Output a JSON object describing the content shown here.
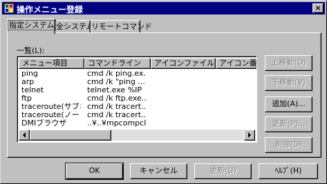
{
  "window": {
    "title": "操作メニュー登録",
    "close_glyph": "×"
  },
  "tabs": [
    {
      "label": "指定システム",
      "active": true
    },
    {
      "label": "全システム",
      "active": false
    },
    {
      "label": "リモートコマンド",
      "active": false
    }
  ],
  "list": {
    "label": "一覧(L):",
    "columns": [
      "メニュー項目",
      "コマンドライン",
      "アイコンファイル",
      "アイコン番号"
    ],
    "rows": [
      [
        "ping",
        "cmd /k ping.ex..."
      ],
      [
        "arp",
        "cmd /k \"ping ..."
      ],
      [
        "telnet",
        "telnet.exe %IP"
      ],
      [
        "ftp",
        "cmd /k ftp.exe..."
      ],
      [
        "traceroute(サブネ...",
        "cmd /k tracert..."
      ],
      [
        "traceroute(ノード)",
        "cmd /k tracert..."
      ],
      [
        "DMIブラウザ",
        "..¥..¥mpcompcl¥..."
      ]
    ]
  },
  "side_buttons": {
    "move_up": "上移動(O)",
    "move_down": "下移動(V)",
    "add": "追加(A)...",
    "update": "更新(P)...",
    "delete": "削除(D)"
  },
  "bottom_buttons": {
    "ok": "OK",
    "cancel": "キャンセル",
    "update": "更新(U)",
    "help": "ﾍﾙﾌﾟ(H)"
  }
}
